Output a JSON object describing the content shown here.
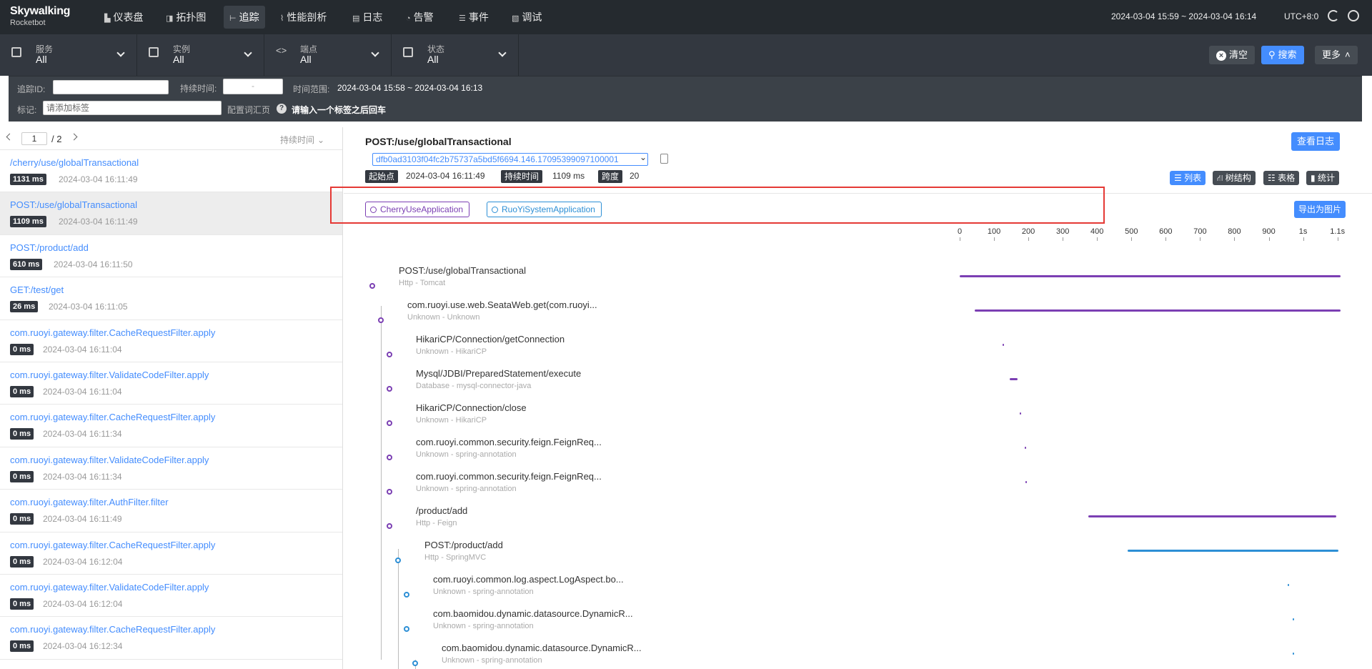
{
  "app": {
    "logo_main": "Skywalking",
    "logo_sub": "Rocketbot"
  },
  "nav": {
    "items": [
      {
        "label": "仪表盘",
        "icon": "dashboard-icon"
      },
      {
        "label": "拓扑图",
        "icon": "topology-icon"
      },
      {
        "label": "追踪",
        "icon": "trace-icon",
        "active": true
      },
      {
        "label": "性能剖析",
        "icon": "profile-icon"
      },
      {
        "label": "日志",
        "icon": "log-icon"
      },
      {
        "label": "告警",
        "icon": "alarm-icon"
      },
      {
        "label": "事件",
        "icon": "event-icon"
      },
      {
        "label": "调试",
        "icon": "debug-icon"
      }
    ],
    "time_range": "2024-03-04 15:59 ~ 2024-03-04 16:14",
    "timezone": "UTC+8:0"
  },
  "filters": {
    "service": {
      "label": "服务",
      "value": "All"
    },
    "instance": {
      "label": "实例",
      "value": "All"
    },
    "endpoint": {
      "label": "端点",
      "value": "All"
    },
    "status": {
      "label": "状态",
      "value": "All"
    },
    "clear_label": "清空",
    "search_label": "搜索",
    "more_label": "更多"
  },
  "advanced": {
    "trace_id_label": "追踪ID:",
    "trace_id_value": "",
    "duration_label": "持续时间:",
    "duration_value": "-",
    "time_range_label": "时间范围:",
    "time_range_value": "2024-03-04 15:58 ~ 2024-03-04 16:13",
    "tags_label": "标记:",
    "tags_placeholder": "请添加标签",
    "config_label": "配置词汇页",
    "hint": "请输入一个标签之后回车"
  },
  "list": {
    "page": "1",
    "total": "/ 2",
    "sort_label": "持续时间",
    "items": [
      {
        "name": "/cherry/use/globalTransactional",
        "duration": "1131 ms",
        "time": "2024-03-04 16:11:49"
      },
      {
        "name": "POST:/use/globalTransactional",
        "duration": "1109 ms",
        "time": "2024-03-04 16:11:49",
        "selected": true
      },
      {
        "name": "POST:/product/add",
        "duration": "610 ms",
        "time": "2024-03-04 16:11:50"
      },
      {
        "name": "GET:/test/get",
        "duration": "26 ms",
        "time": "2024-03-04 16:11:05"
      },
      {
        "name": "com.ruoyi.gateway.filter.CacheRequestFilter.apply",
        "duration": "0 ms",
        "time": "2024-03-04 16:11:04"
      },
      {
        "name": "com.ruoyi.gateway.filter.ValidateCodeFilter.apply",
        "duration": "0 ms",
        "time": "2024-03-04 16:11:04"
      },
      {
        "name": "com.ruoyi.gateway.filter.CacheRequestFilter.apply",
        "duration": "0 ms",
        "time": "2024-03-04 16:11:34"
      },
      {
        "name": "com.ruoyi.gateway.filter.ValidateCodeFilter.apply",
        "duration": "0 ms",
        "time": "2024-03-04 16:11:34"
      },
      {
        "name": "com.ruoyi.gateway.filter.AuthFilter.filter",
        "duration": "0 ms",
        "time": "2024-03-04 16:11:49"
      },
      {
        "name": "com.ruoyi.gateway.filter.CacheRequestFilter.apply",
        "duration": "0 ms",
        "time": "2024-03-04 16:12:04"
      },
      {
        "name": "com.ruoyi.gateway.filter.ValidateCodeFilter.apply",
        "duration": "0 ms",
        "time": "2024-03-04 16:12:04"
      },
      {
        "name": "com.ruoyi.gateway.filter.CacheRequestFilter.apply",
        "duration": "0 ms",
        "time": "2024-03-04 16:12:34"
      }
    ]
  },
  "detail": {
    "title": "POST:/use/globalTransactional",
    "view_logs_label": "查看日志",
    "trace_id": "dfb0ad3103f04fc2b75737a5bd5f6694.146.17095399097100001",
    "start_label": "起始点",
    "start_value": "2024-03-04 16:11:49",
    "duration_label": "持续时间",
    "duration_value": "1109 ms",
    "spans_label": "跨度",
    "spans_value": "20",
    "views": [
      {
        "label": "列表",
        "active": true
      },
      {
        "label": "树结构"
      },
      {
        "label": "表格"
      },
      {
        "label": "统计"
      }
    ],
    "export_label": "导出为图片",
    "services": [
      {
        "name": "CherryUseApplication",
        "color": "#7b3fb3"
      },
      {
        "name": "RuoYiSystemApplication",
        "color": "#2d8fd5"
      }
    ],
    "scale_ticks": [
      "0",
      "100",
      "200",
      "300",
      "400",
      "500",
      "600",
      "700",
      "800",
      "900",
      "1s",
      "1.1s"
    ],
    "scale_max_ms": 1109,
    "spans": [
      {
        "name": "POST:/use/globalTransactional",
        "sub": "Http - Tomcat",
        "depth": 0,
        "service": 0,
        "start": 0,
        "end": 1109
      },
      {
        "name": "com.ruoyi.use.web.SeataWeb.get(com.ruoyi...",
        "sub": "Unknown - Unknown",
        "depth": 1,
        "service": 0,
        "start": 43,
        "end": 1109
      },
      {
        "name": "HikariCP/Connection/getConnection",
        "sub": "Unknown - HikariCP",
        "depth": 2,
        "service": 0,
        "start": 125,
        "end": 127
      },
      {
        "name": "Mysql/JDBI/PreparedStatement/execute",
        "sub": "Database - mysql-connector-java",
        "depth": 2,
        "service": 0,
        "start": 145,
        "end": 168
      },
      {
        "name": "HikariCP/Connection/close",
        "sub": "Unknown - HikariCP",
        "depth": 2,
        "service": 0,
        "start": 174,
        "end": 175
      },
      {
        "name": "com.ruoyi.common.security.feign.FeignReq...",
        "sub": "Unknown - spring-annotation",
        "depth": 2,
        "service": 0,
        "start": 190,
        "end": 191
      },
      {
        "name": "com.ruoyi.common.security.feign.FeignReq...",
        "sub": "Unknown - spring-annotation",
        "depth": 2,
        "service": 0,
        "start": 191,
        "end": 192
      },
      {
        "name": "/product/add",
        "sub": "Http - Feign",
        "depth": 2,
        "service": 0,
        "start": 375,
        "end": 1096
      },
      {
        "name": "POST:/product/add",
        "sub": "Http - SpringMVC",
        "depth": 3,
        "service": 1,
        "start": 488,
        "end": 1102
      },
      {
        "name": "com.ruoyi.common.log.aspect.LogAspect.bo...",
        "sub": "Unknown - spring-annotation",
        "depth": 4,
        "service": 1,
        "start": 954,
        "end": 955
      },
      {
        "name": "com.baomidou.dynamic.datasource.DynamicR...",
        "sub": "Unknown - spring-annotation",
        "depth": 4,
        "service": 1,
        "start": 969,
        "end": 970
      },
      {
        "name": "com.baomidou.dynamic.datasource.DynamicR...",
        "sub": "Unknown - spring-annotation",
        "depth": 5,
        "service": 1,
        "start": 969,
        "end": 970
      }
    ]
  }
}
